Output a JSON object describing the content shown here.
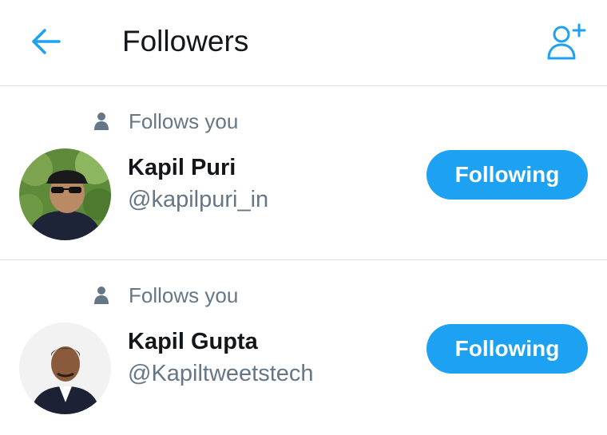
{
  "header": {
    "title": "Followers",
    "back_icon": "arrow-left-icon",
    "add_icon": "add-user-icon"
  },
  "colors": {
    "accent": "#1da1f2",
    "text_primary": "#14171a",
    "text_secondary": "#657786",
    "divider": "#d8dde1"
  },
  "followers": [
    {
      "follows_you": "Follows you",
      "name": "Kapil Puri",
      "handle": "@kapilpuri_in",
      "button": "Following"
    },
    {
      "follows_you": "Follows you",
      "name": "Kapil Gupta",
      "handle": "@Kapiltweetstech",
      "button": "Following"
    }
  ]
}
